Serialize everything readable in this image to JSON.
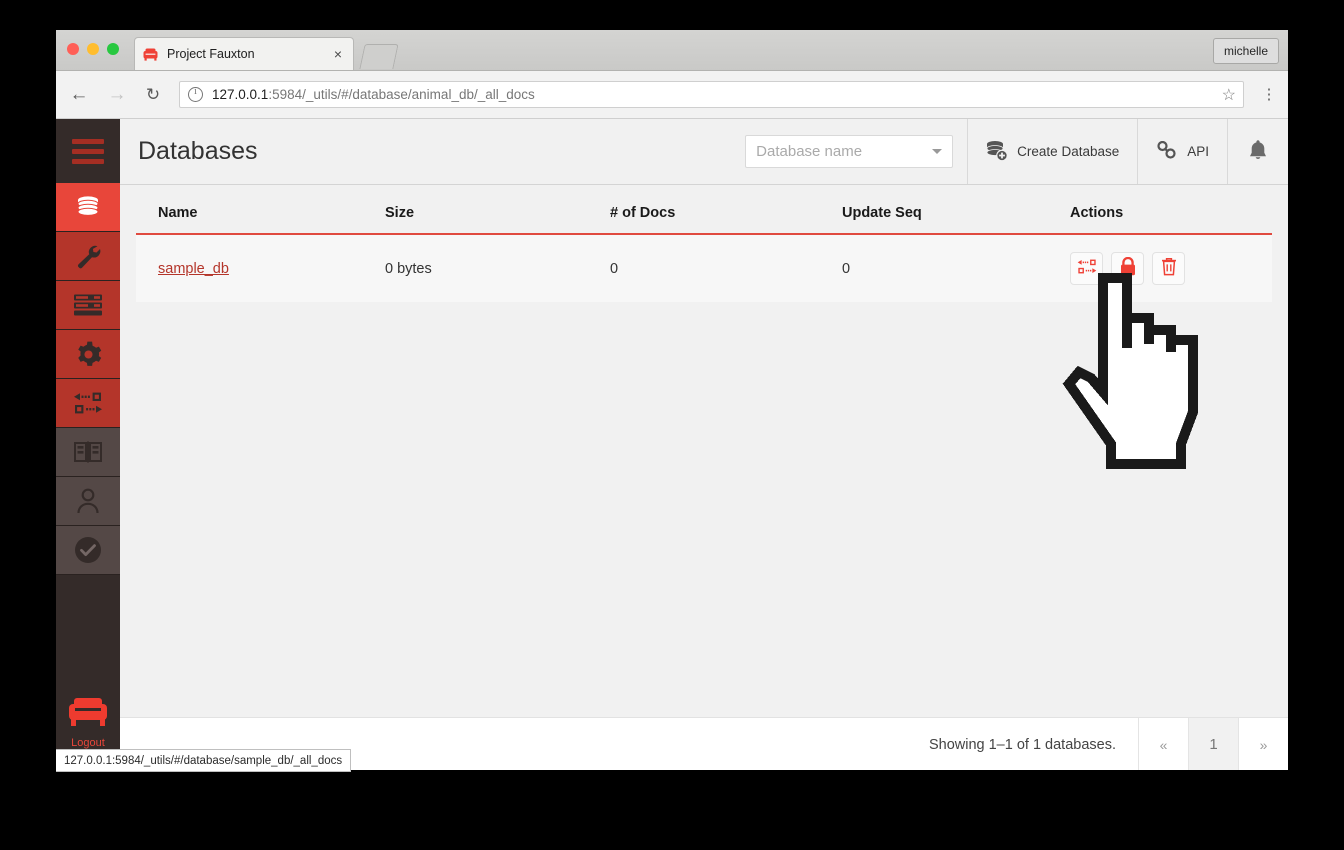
{
  "browser": {
    "tab": {
      "title": "Project Fauxton",
      "favicon": "couch-icon",
      "close": "×"
    },
    "user_chip": "michelle",
    "nav": {
      "back": "←",
      "forward": "→",
      "reload": "↻",
      "menu": "⋮",
      "star": "☆"
    },
    "omnibox": {
      "host": "127.0.0.1",
      "rest": ":5984/_utils/#/database/animal_db/_all_docs",
      "full": "127.0.0.1:5984/_utils/#/database/animal_db/_all_docs"
    },
    "status_bar": "127.0.0.1:5984/_utils/#/database/sample_db/_all_docs"
  },
  "sidebar": {
    "menu_toggle": "hamburger-icon",
    "items": [
      {
        "name": "databases",
        "icon": "database-icon",
        "state": "active"
      },
      {
        "name": "setup",
        "icon": "wrench-icon",
        "state": "red"
      },
      {
        "name": "active-tasks",
        "icon": "server-stack-icon",
        "state": "red"
      },
      {
        "name": "configuration",
        "icon": "gear-icon",
        "state": "red"
      },
      {
        "name": "replication",
        "icon": "replication-icon",
        "state": "red"
      },
      {
        "name": "documentation",
        "icon": "book-icon",
        "state": "grey"
      },
      {
        "name": "user-management",
        "icon": "user-icon",
        "state": "grey"
      },
      {
        "name": "verify",
        "icon": "check-circle-icon",
        "state": "grey"
      }
    ],
    "logo": "couch-logo",
    "logout_label": "Logout"
  },
  "header": {
    "title": "Databases",
    "search": {
      "placeholder": "Database name",
      "value": ""
    },
    "create_database_label": "Create Database",
    "api_label": "API",
    "bell": "notification-bell-icon"
  },
  "table": {
    "columns": [
      "Name",
      "Size",
      "# of Docs",
      "Update Seq",
      "Actions"
    ],
    "rows": [
      {
        "name": "sample_db",
        "size": "0 bytes",
        "docs": "0",
        "update_seq": "0",
        "actions": [
          "replicate",
          "permissions",
          "delete"
        ]
      }
    ]
  },
  "footer": {
    "showing": "Showing 1–1 of 1 databases.",
    "pager": {
      "prev": "«",
      "current": "1",
      "next": "»"
    }
  },
  "colors": {
    "brand_red": "#e8463a",
    "sidebar_dark": "#342b29",
    "sidebar_red": "#b4352a",
    "sidebar_grey": "#544846",
    "link_red": "#b4352a",
    "header_bg": "#f1f1f1"
  }
}
